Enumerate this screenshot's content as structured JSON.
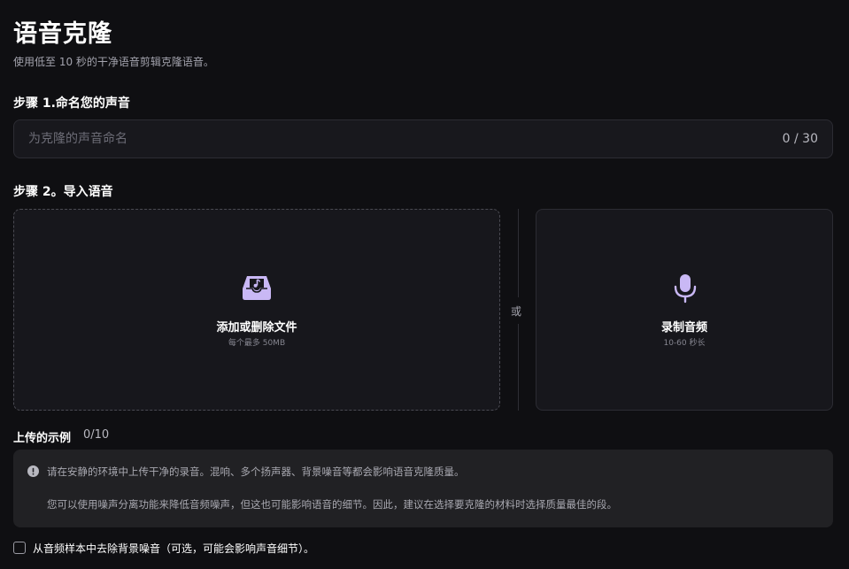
{
  "header": {
    "title": "语音克隆",
    "subtitle": "使用低至 10 秒的干净语音剪辑克隆语音。"
  },
  "step1": {
    "label": "步骤 1.命名您的声音",
    "placeholder": "为克隆的声音命名",
    "value": "",
    "counter": "0 / 30"
  },
  "step2": {
    "label": "步骤 2。导入语音",
    "upload": {
      "icon": "inbox-music-icon",
      "title": "添加或删除文件",
      "subtitle": "每个最多 50MB"
    },
    "or_text": "或",
    "record": {
      "icon": "microphone-icon",
      "title": "录制音频",
      "subtitle": "10-60 秒长"
    }
  },
  "samples": {
    "label": "上传的示例",
    "count": "0/10"
  },
  "notice": {
    "icon": "exclamation-circle-icon",
    "line1": "请在安静的环境中上传干净的录音。混响、多个扬声器、背景噪音等都会影响语音克隆质量。",
    "line2": "您可以使用噪声分离功能来降低音频噪声，但这也可能影响语音的细节。因此，建议在选择要克隆的材料时选择质量最佳的段。"
  },
  "noise_option": {
    "label": "从音频样本中去除背景噪音（可选，可能会影响声音细节）。",
    "checked": false
  },
  "colors": {
    "background": "#0f0f12",
    "accent": "#c9b8f5"
  }
}
